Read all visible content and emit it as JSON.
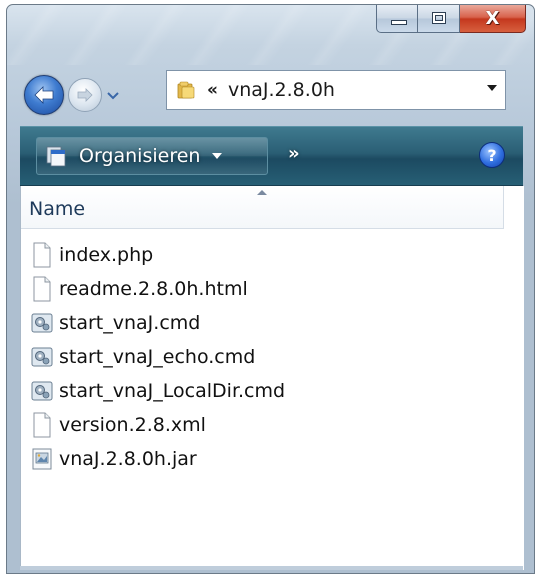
{
  "window": {
    "caption_buttons": {
      "minimize_icon": "minimize-icon",
      "maximize_icon": "maximize-icon",
      "close_glyph": "X"
    }
  },
  "navigation": {
    "back_icon": "back-arrow-icon",
    "forward_icon": "forward-arrow-icon",
    "history_icon": "chevron-down-icon"
  },
  "address_bar": {
    "folder_icon": "folder-icon",
    "chevrons": "«",
    "path": "vnaJ.2.8.0h"
  },
  "toolbar": {
    "organize_label": "Organisieren",
    "more_label": "»",
    "help_label": "?"
  },
  "columns": {
    "name_header": "Name"
  },
  "files": [
    {
      "name": "index.php",
      "icon": "document-icon"
    },
    {
      "name": "readme.2.8.0h.html",
      "icon": "document-icon"
    },
    {
      "name": "start_vnaJ.cmd",
      "icon": "script-gear-icon"
    },
    {
      "name": "start_vnaJ_echo.cmd",
      "icon": "script-gear-icon"
    },
    {
      "name": "start_vnaJ_LocalDir.cmd",
      "icon": "script-gear-icon"
    },
    {
      "name": "version.2.8.xml",
      "icon": "document-icon"
    },
    {
      "name": "vnaJ.2.8.0h.jar",
      "icon": "jar-archive-icon"
    }
  ],
  "colors": {
    "toolbar_bg": "#2a5e74",
    "close_button": "#c4381e",
    "back_button": "#3f7cd0"
  }
}
